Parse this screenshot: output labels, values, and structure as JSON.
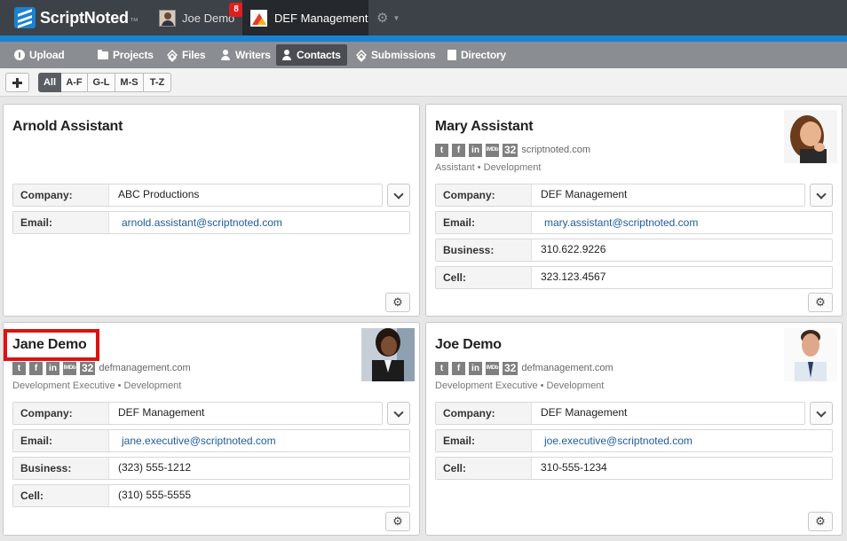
{
  "app": {
    "brand_name": "ScriptNoted",
    "brand_suffix": "™",
    "user_name": "Joe Demo",
    "notification_count": "8",
    "company_name": "DEF Management",
    "gear_glyph": "⚙",
    "caret_glyph": "▼"
  },
  "nav": {
    "items": [
      {
        "label": "Upload",
        "icon": "upload-icon"
      },
      {
        "label": "Projects",
        "icon": "folder-icon"
      },
      {
        "label": "Files",
        "icon": "layers-icon"
      },
      {
        "label": "Writers",
        "icon": "person-icon"
      },
      {
        "label": "Contacts",
        "icon": "person-icon"
      },
      {
        "label": "Submissions",
        "icon": "layers-icon"
      },
      {
        "label": "Directory",
        "icon": "book-icon"
      }
    ],
    "active": "Contacts"
  },
  "filters": {
    "items": [
      "All",
      "A-F",
      "G-L",
      "M-S",
      "T-Z"
    ],
    "active": "All"
  },
  "social": {
    "twitter": "t",
    "facebook": "f",
    "linkedin": "in",
    "imdb": "IMDb"
  },
  "labels": {
    "company": "Company:",
    "email": "Email:",
    "business": "Business:",
    "cell": "Cell:",
    "role_separator": "•",
    "gear_glyph": "⚙"
  },
  "contacts": [
    {
      "name": "Arnold Assistant",
      "company": "ABC Productions",
      "email": "arnold.assistant@scriptnoted.com"
    },
    {
      "name": "Mary Assistant",
      "count": "32",
      "domain": "scriptnoted.com",
      "title": "Assistant",
      "department": "Development",
      "company": "DEF Management",
      "email": "mary.assistant@scriptnoted.com",
      "business": "310.622.9226",
      "cell": "323.123.4567"
    },
    {
      "name": "Jane Demo",
      "count": "32",
      "domain": "defmanagement.com",
      "title": "Development Executive",
      "department": "Development",
      "company": "DEF Management",
      "email": "jane.executive@scriptnoted.com",
      "business": "(323) 555-1212",
      "cell": "(310) 555-5555"
    },
    {
      "name": "Joe Demo",
      "count": "32",
      "domain": "defmanagement.com",
      "title": "Development Executive",
      "department": "Development",
      "company": "DEF Management",
      "email": "joe.executive@scriptnoted.com",
      "cell": "310-555-1234"
    }
  ],
  "colors": {
    "topbar": "#3d4248",
    "accent": "#1a82d1",
    "navbar": "#8a8d91",
    "highlight": "#e01010",
    "link": "#1e5b9c"
  }
}
